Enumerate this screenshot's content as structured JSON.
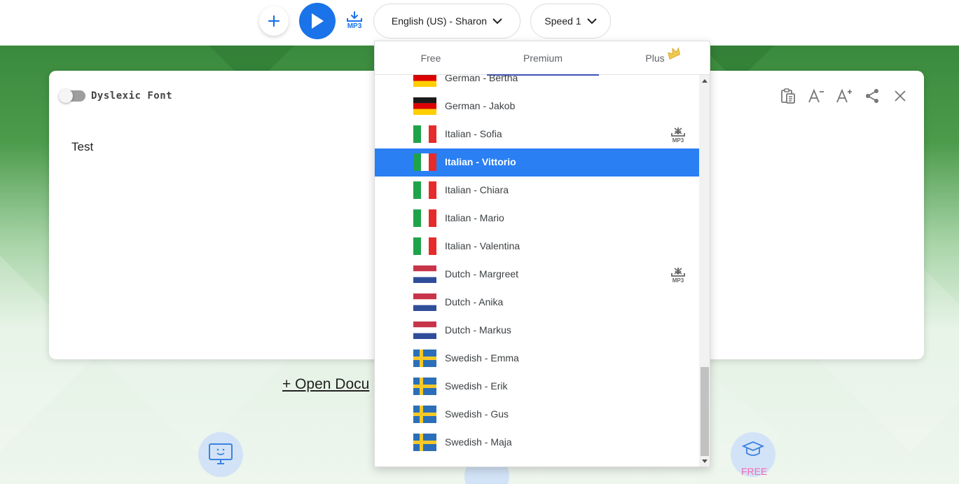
{
  "toolbar": {
    "add_icon": "plus-icon",
    "play_icon": "play-icon",
    "mp3_label": "MP3",
    "voice_label": "English (US) - Sharon",
    "speed_label": "Speed 1"
  },
  "editor": {
    "dyslexic_label": "Dyslexic Font",
    "dyslexic_enabled": false,
    "text": "Test",
    "tools": [
      "clipboard-icon",
      "decrease-font-icon",
      "increase-font-icon",
      "share-icon",
      "close-icon"
    ]
  },
  "page": {
    "open_document_label": "+ Open Docu",
    "free_label": "FREE"
  },
  "dropdown": {
    "tabs": [
      {
        "label": "Free"
      },
      {
        "label": "Premium",
        "active": true
      },
      {
        "label": "Plus"
      }
    ],
    "voices": [
      {
        "label": "German - Bertha",
        "flag": "de"
      },
      {
        "label": "German - Jakob",
        "flag": "de"
      },
      {
        "label": "Italian - Sofia",
        "flag": "it",
        "mp3": true
      },
      {
        "label": "Italian - Vittorio",
        "flag": "it",
        "selected": true
      },
      {
        "label": "Italian - Chiara",
        "flag": "it"
      },
      {
        "label": "Italian - Mario",
        "flag": "it"
      },
      {
        "label": "Italian - Valentina",
        "flag": "it"
      },
      {
        "label": "Dutch - Margreet",
        "flag": "nl",
        "mp3": true
      },
      {
        "label": "Dutch - Anika",
        "flag": "nl"
      },
      {
        "label": "Dutch - Markus",
        "flag": "nl"
      },
      {
        "label": "Swedish - Emma",
        "flag": "se"
      },
      {
        "label": "Swedish - Erik",
        "flag": "se"
      },
      {
        "label": "Swedish - Gus",
        "flag": "se"
      },
      {
        "label": "Swedish - Maja",
        "flag": "se"
      }
    ],
    "mp3_badge": "MP3"
  },
  "colors": {
    "accent": "#1a73e8",
    "selected": "#2a7ff3",
    "tab_indicator": "#3f51b5"
  }
}
